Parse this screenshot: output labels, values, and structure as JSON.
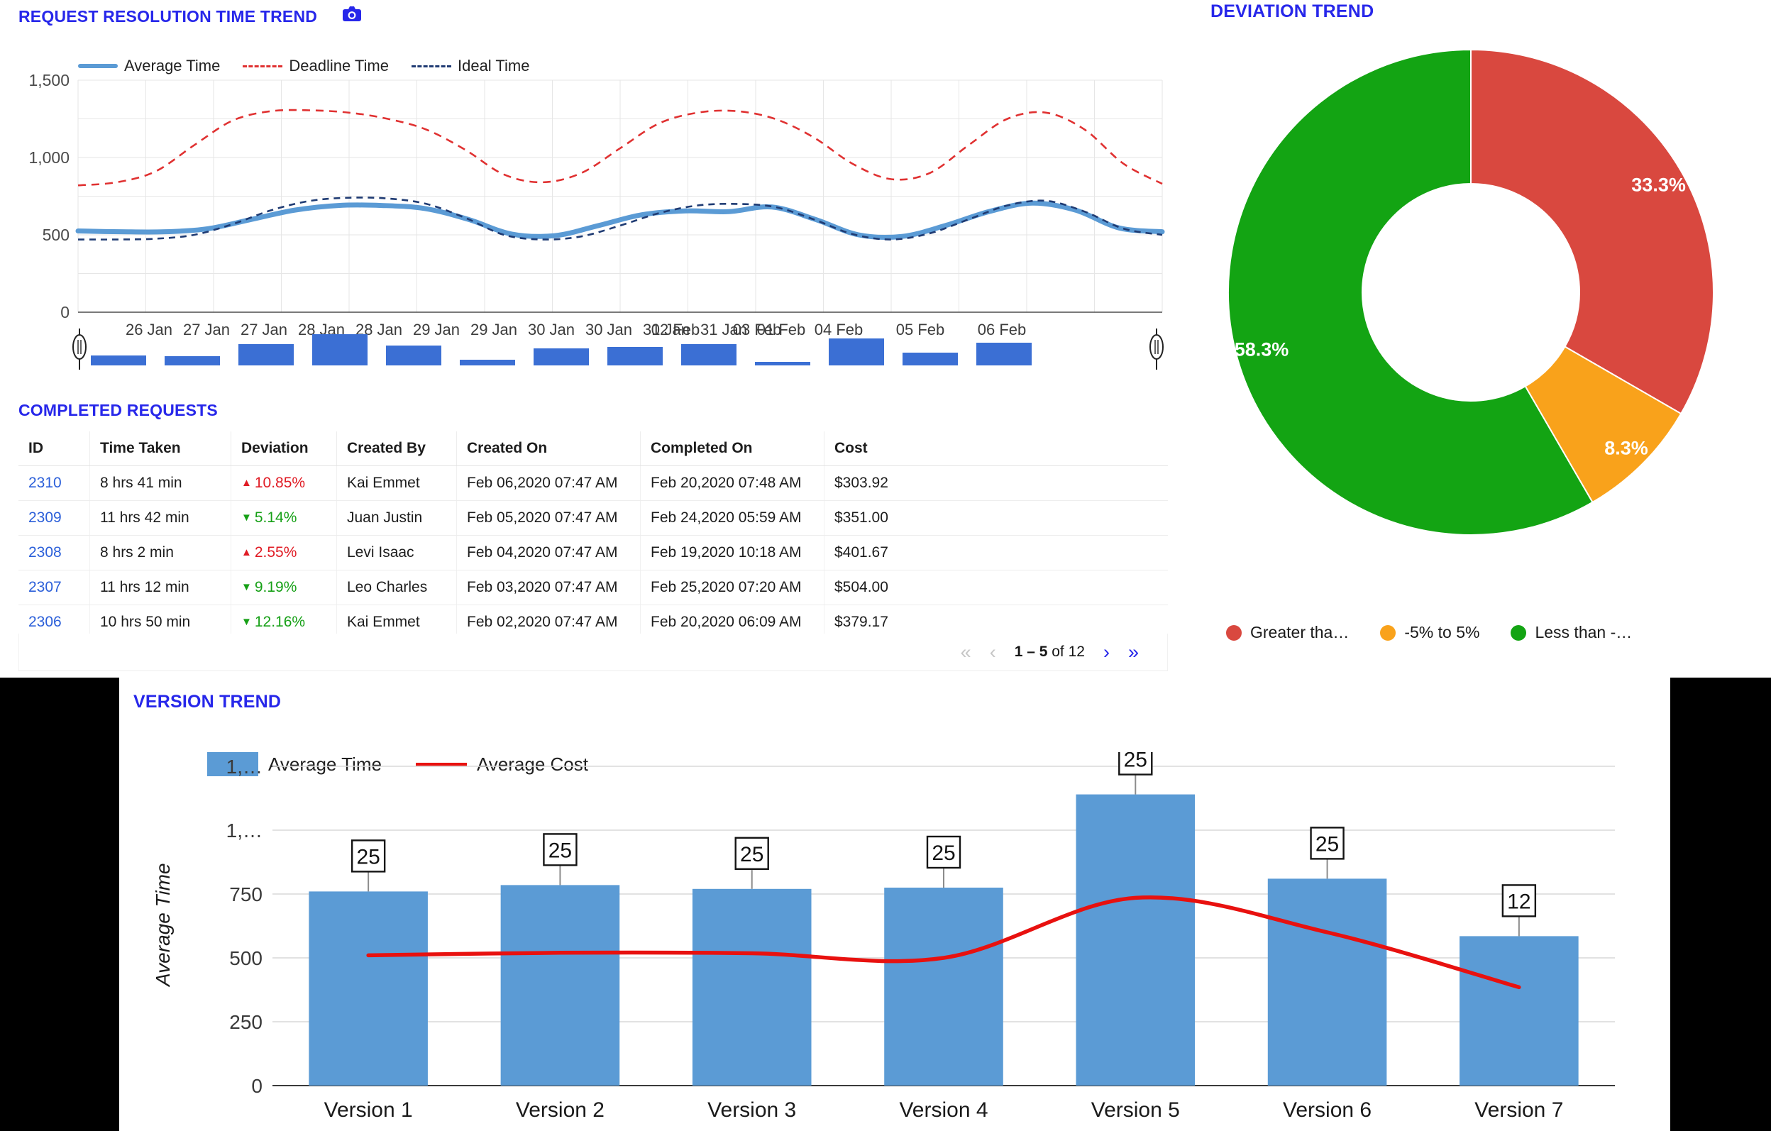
{
  "resolution_trend": {
    "title": "REQUEST RESOLUTION TIME TREND",
    "camera_icon": "camera-icon",
    "legend": [
      {
        "label": "Average Time",
        "style": "solid",
        "color": "#5b9bd5"
      },
      {
        "label": "Deadline Time",
        "style": "dashed",
        "color": "#e03131"
      },
      {
        "label": "Ideal Time",
        "style": "dashed",
        "color": "#1f3b73"
      }
    ],
    "chart_data": {
      "type": "line",
      "title": "REQUEST RESOLUTION TIME TREND",
      "xlabel": "",
      "ylabel": "",
      "ylim": [
        0,
        1500
      ],
      "yticks": [
        "0",
        "500",
        "1,000",
        "1,500"
      ],
      "grid": true,
      "legend_position": "top",
      "categories": [
        "26 Jan",
        "27 Jan",
        "27 Jan",
        "28 Jan",
        "28 Jan",
        "29 Jan",
        "29 Jan",
        "30 Jan",
        "30 Jan",
        "31 Jan",
        "31 Jan",
        "01 Feb",
        "02 Feb",
        "03 Feb",
        "04 Feb",
        "05 Feb",
        "06 Feb"
      ],
      "series": [
        {
          "name": "Average Time",
          "color": "#5b9bd5",
          "values": [
            525,
            520,
            520,
            540,
            600,
            660,
            690,
            690,
            670,
            600,
            505,
            495,
            560,
            630,
            655,
            650,
            680,
            600,
            500,
            490,
            560,
            650,
            705,
            660,
            545,
            520
          ]
        },
        {
          "name": "Deadline Time",
          "color": "#e03131",
          "values": [
            820,
            840,
            910,
            1080,
            1240,
            1300,
            1305,
            1290,
            1250,
            1180,
            1050,
            890,
            840,
            900,
            1060,
            1220,
            1290,
            1300,
            1250,
            1130,
            960,
            860,
            900,
            1080,
            1250,
            1290,
            1180,
            960,
            830
          ]
        },
        {
          "name": "Ideal Time",
          "color": "#1f3b73",
          "values": [
            470,
            470,
            475,
            500,
            570,
            660,
            720,
            740,
            735,
            700,
            610,
            500,
            470,
            490,
            560,
            640,
            690,
            700,
            680,
            600,
            505,
            470,
            510,
            600,
            690,
            720,
            650,
            540,
            500
          ]
        }
      ],
      "range_selector": {
        "handles": [
          "left-handle",
          "right-handle"
        ],
        "bars": [
          14,
          13,
          30,
          44,
          28,
          8,
          24,
          26,
          30,
          5,
          38,
          18,
          32
        ]
      }
    }
  },
  "completed_requests": {
    "title": "COMPLETED REQUESTS",
    "columns": [
      "ID",
      "Time Taken",
      "Deviation",
      "Created By",
      "Created On",
      "Completed On",
      "Cost"
    ],
    "rows": [
      {
        "id": "2310",
        "time_taken": "8 hrs 41 min",
        "deviation": "10.85%",
        "deviation_dir": "up",
        "created_by": "Kai Emmet",
        "created_on": "Feb 06,2020 07:47 AM",
        "completed_on": "Feb 20,2020 07:48 AM",
        "cost": "$303.92"
      },
      {
        "id": "2309",
        "time_taken": "11 hrs 42 min",
        "deviation": "5.14%",
        "deviation_dir": "down",
        "created_by": "Juan Justin",
        "created_on": "Feb 05,2020 07:47 AM",
        "completed_on": "Feb 24,2020 05:59 AM",
        "cost": "$351.00"
      },
      {
        "id": "2308",
        "time_taken": "8 hrs 2 min",
        "deviation": "2.55%",
        "deviation_dir": "up",
        "created_by": "Levi Isaac",
        "created_on": "Feb 04,2020 07:47 AM",
        "completed_on": "Feb 19,2020 10:18 AM",
        "cost": "$401.67"
      },
      {
        "id": "2307",
        "time_taken": "11 hrs 12 min",
        "deviation": "9.19%",
        "deviation_dir": "down",
        "created_by": "Leo Charles",
        "created_on": "Feb 03,2020 07:47 AM",
        "completed_on": "Feb 25,2020 07:20 AM",
        "cost": "$504.00"
      },
      {
        "id": "2306",
        "time_taken": "10 hrs 50 min",
        "deviation": "12.16%",
        "deviation_dir": "down",
        "created_by": "Kai Emmet",
        "created_on": "Feb 02,2020 07:47 AM",
        "completed_on": "Feb 20,2020 06:09 AM",
        "cost": "$379.17"
      }
    ],
    "pagination": {
      "first_label": "«",
      "prev_label": "‹",
      "range_prefix": "1 – 5",
      "range_suffix": " of 12",
      "next_label": "›",
      "last_label": "»"
    }
  },
  "deviation_trend": {
    "title": "DEVIATION TREND",
    "chart_data": {
      "type": "pie",
      "title": "DEVIATION TREND",
      "donut": true,
      "legend_position": "bottom",
      "labels": [
        "Greater tha…",
        "-5% to 5%",
        "Less than -…"
      ],
      "values": [
        33.3,
        8.3,
        58.3
      ],
      "value_labels": [
        "33.3%",
        "8.3%",
        "58.3%"
      ],
      "colors": [
        "#d9483f",
        "#f9a21b",
        "#13a413"
      ]
    }
  },
  "version_trend": {
    "title": "VERSION TREND",
    "legend": [
      {
        "label": "Average Time",
        "type": "bar",
        "color": "#5b9bd5"
      },
      {
        "label": "Average Cost",
        "type": "line",
        "color": "#e8110f"
      }
    ],
    "chart_data": {
      "type": "bar",
      "title": "VERSION TREND",
      "xlabel": "",
      "ylabel": "Average Time",
      "ylim": [
        0,
        1250
      ],
      "yticks": [
        "0",
        "250",
        "500",
        "750",
        "1,…",
        "1,…"
      ],
      "ytick_values": [
        0,
        250,
        500,
        750,
        1000,
        1250
      ],
      "grid": true,
      "legend_position": "top",
      "categories": [
        "Version 1",
        "Version 2",
        "Version 3",
        "Version 4",
        "Version 5",
        "Version 6",
        "Version 7"
      ],
      "series": [
        {
          "name": "Average Time",
          "type": "bar",
          "color": "#5b9bd5",
          "values": [
            760,
            785,
            770,
            775,
            1140,
            810,
            585
          ]
        },
        {
          "name": "Average Cost",
          "type": "line",
          "color": "#e8110f",
          "values": [
            510,
            520,
            518,
            500,
            735,
            600,
            385
          ]
        }
      ],
      "point_labels": [
        "25",
        "25",
        "25",
        "25",
        "25",
        "25",
        "12"
      ]
    }
  }
}
